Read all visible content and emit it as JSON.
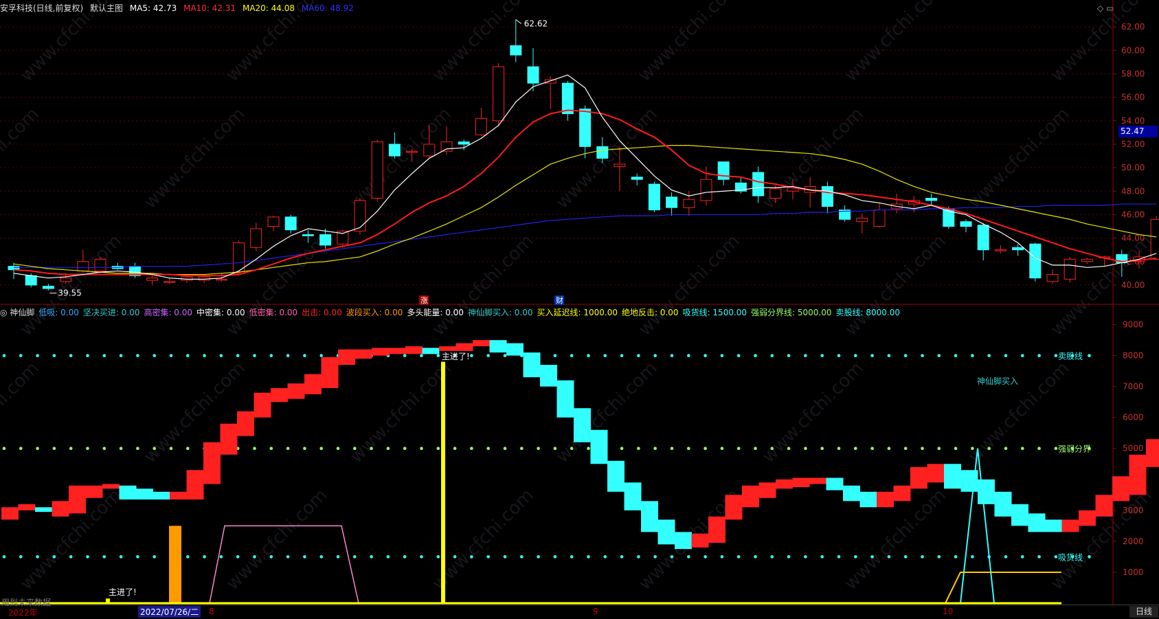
{
  "header": {
    "stock": "安孚科技(日线,前复权)",
    "main_chart_label": "默认主图",
    "ma": [
      {
        "label": "MA5: 42.73",
        "color": "#ffffff"
      },
      {
        "label": "MA10: 42.31",
        "color": "#ff3030"
      },
      {
        "label": "MA20: 44.08",
        "color": "#ffff00"
      },
      {
        "label": "MA60: 48.92",
        "color": "#3030ff"
      }
    ]
  },
  "indicator_header": {
    "name": "神仙脚",
    "items": [
      {
        "label": "低吸: 0.00",
        "color": "#33aaff"
      },
      {
        "label": "坚决买进: 0.00",
        "color": "#33cccc"
      },
      {
        "label": "高密集: 0.00",
        "color": "#cc66ff"
      },
      {
        "label": "中密集: 0.00",
        "color": "#ffffff"
      },
      {
        "label": "低密集: 0.00",
        "color": "#ff66aa"
      },
      {
        "label": "出击: 0.00",
        "color": "#ff2020"
      },
      {
        "label": "波段买入: 0.00",
        "color": "#ff9900"
      },
      {
        "label": "多头能量: 0.00",
        "color": "#ffffff"
      },
      {
        "label": "神仙脚买入: 0.00",
        "color": "#33cccc"
      },
      {
        "label": "买入延迟线: 1000.00",
        "color": "#ffff00"
      },
      {
        "label": "绝地反击: 0.00",
        "color": "#ffff00"
      },
      {
        "label": "吸货线: 1500.00",
        "color": "#33ffff"
      },
      {
        "label": "强弱分界线: 5000.00",
        "color": "#99ff66"
      },
      {
        "label": "卖股线: 8000.00",
        "color": "#33ffff"
      }
    ]
  },
  "chart_data": [
    {
      "type": "candlestick",
      "title": "安孚科技(日线,前复权)",
      "ylim": [
        39,
        63
      ],
      "yticks": [
        "62.00",
        "60.00",
        "58.00",
        "56.00",
        "54.00",
        "52.00",
        "50.00",
        "48.00",
        "46.00",
        "44.00",
        "42.00",
        "40.00"
      ],
      "current_price": "52.47",
      "high_label": "62.62",
      "low_label": "39.55",
      "markers": [
        "涨",
        "财"
      ],
      "candles": [
        [
          41.6,
          41.3,
          41.9,
          40.5
        ],
        [
          40.8,
          40.0,
          41.0,
          39.8
        ],
        [
          39.9,
          39.7,
          40.1,
          39.55
        ],
        [
          40.3,
          40.6,
          41.0,
          40.1
        ],
        [
          41.2,
          42.0,
          43.0,
          41.0
        ],
        [
          41.2,
          42.2,
          42.4,
          41.0
        ],
        [
          41.6,
          41.4,
          41.9,
          41.3
        ],
        [
          41.6,
          40.8,
          41.9,
          40.6
        ],
        [
          40.4,
          40.6,
          40.8,
          40.0
        ],
        [
          40.3,
          40.3,
          40.6,
          40.1
        ],
        [
          40.4,
          40.7,
          40.9,
          40.2
        ],
        [
          40.4,
          40.7,
          40.9,
          40.2
        ],
        [
          40.5,
          40.5,
          41.0,
          40.3
        ],
        [
          41.0,
          43.6,
          43.8,
          40.8
        ],
        [
          43.2,
          44.8,
          45.3,
          42.9
        ],
        [
          45.0,
          45.8,
          45.9,
          44.6
        ],
        [
          45.8,
          44.7,
          46.0,
          44.4
        ],
        [
          44.3,
          44.2,
          44.7,
          43.6
        ],
        [
          44.3,
          43.4,
          44.8,
          43.1
        ],
        [
          43.5,
          44.6,
          44.7,
          43.2
        ],
        [
          44.6,
          47.2,
          47.4,
          44.3
        ],
        [
          47.4,
          52.2,
          52.4,
          47.1
        ],
        [
          52.0,
          51.0,
          53.0,
          50.8
        ],
        [
          51.4,
          51.4,
          51.6,
          50.5
        ],
        [
          51.0,
          52.0,
          53.6,
          50.8
        ],
        [
          51.4,
          52.2,
          53.5,
          51.1
        ],
        [
          52.2,
          52.0,
          52.4,
          51.5
        ],
        [
          52.8,
          54.2,
          55.1,
          52.7
        ],
        [
          54.0,
          58.6,
          58.9,
          53.5
        ],
        [
          60.4,
          59.6,
          62.62,
          59.0
        ],
        [
          58.6,
          57.2,
          60.2,
          56.5
        ],
        [
          57.2,
          57.5,
          57.8,
          55.0
        ],
        [
          57.2,
          54.6,
          57.4,
          54.0
        ],
        [
          55.0,
          51.8,
          55.3,
          50.8
        ],
        [
          51.8,
          50.8,
          52.6,
          50.4
        ],
        [
          50.1,
          50.3,
          51.8,
          48.0
        ],
        [
          49.2,
          49.0,
          49.5,
          48.5
        ],
        [
          48.6,
          46.4,
          48.8,
          46.2
        ],
        [
          47.5,
          46.6,
          47.9,
          45.9
        ],
        [
          46.6,
          47.3,
          48.0,
          45.9
        ],
        [
          47.2,
          49.0,
          50.1,
          46.8
        ],
        [
          50.5,
          49.0,
          50.5,
          48.5
        ],
        [
          48.7,
          48.0,
          49.2,
          47.8
        ],
        [
          49.6,
          47.6,
          50.1,
          47.0
        ],
        [
          47.4,
          48.2,
          48.5,
          47.0
        ],
        [
          48.0,
          48.3,
          49.0,
          47.3
        ],
        [
          47.9,
          48.4,
          49.2,
          46.6
        ],
        [
          48.4,
          46.7,
          48.8,
          46.1
        ],
        [
          46.4,
          45.6,
          46.8,
          45.4
        ],
        [
          45.4,
          45.7,
          46.1,
          44.4
        ],
        [
          45.0,
          46.4,
          47.0,
          44.9
        ],
        [
          46.5,
          46.9,
          47.8,
          46.1
        ],
        [
          46.9,
          47.2,
          47.6,
          46.2
        ],
        [
          47.4,
          47.2,
          47.8,
          46.8
        ],
        [
          46.5,
          45.0,
          46.7,
          44.8
        ],
        [
          45.4,
          45.0,
          45.6,
          44.5
        ],
        [
          45.1,
          43.0,
          45.3,
          42.1
        ],
        [
          43.0,
          43.0,
          43.4,
          42.7
        ],
        [
          43.2,
          43.0,
          43.5,
          42.5
        ],
        [
          43.5,
          40.6,
          43.6,
          40.3
        ],
        [
          40.3,
          40.9,
          41.3,
          40.1
        ],
        [
          40.5,
          42.2,
          42.4,
          40.2
        ],
        [
          42.0,
          42.2,
          42.3,
          41.8
        ],
        [
          42.4,
          42.4,
          42.5,
          41.6
        ],
        [
          42.6,
          41.9,
          43.0,
          40.7
        ],
        [
          42.0,
          42.4,
          42.9,
          41.4
        ],
        [
          42.2,
          45.6,
          45.9,
          42.1
        ]
      ],
      "ma5": [
        41.0,
        40.8,
        40.6,
        40.7,
        40.9,
        41.1,
        41.2,
        41.1,
        40.9,
        40.6,
        40.5,
        40.5,
        40.6,
        41.2,
        42.2,
        43.3,
        44.2,
        44.8,
        44.6,
        44.4,
        44.9,
        46.3,
        48.1,
        49.5,
        50.8,
        51.6,
        51.7,
        52.5,
        53.6,
        55.6,
        56.9,
        57.4,
        57.9,
        56.8,
        54.3,
        52.3,
        50.8,
        49.3,
        48.1,
        47.6,
        47.9,
        48.0,
        48.1,
        48.3,
        48.3,
        48.4,
        48.1,
        48.0,
        47.7,
        47.2,
        47.0,
        46.7,
        46.5,
        46.8,
        46.3,
        46.0,
        45.2,
        44.5,
        43.6,
        42.3,
        41.7,
        41.7,
        41.5,
        41.6,
        41.9,
        42.2,
        42.7
      ],
      "ma10": [
        41.3,
        41.2,
        41.0,
        40.9,
        40.9,
        40.9,
        40.9,
        40.9,
        40.9,
        40.9,
        40.8,
        40.8,
        40.8,
        40.9,
        41.3,
        41.8,
        42.3,
        42.7,
        43.0,
        43.3,
        43.6,
        44.3,
        45.2,
        46.2,
        47.0,
        47.6,
        48.4,
        49.5,
        50.9,
        52.6,
        53.9,
        54.6,
        54.9,
        54.8,
        54.6,
        54.1,
        53.3,
        52.6,
        51.5,
        50.2,
        49.5,
        49.3,
        49.2,
        48.8,
        48.6,
        48.3,
        48.1,
        47.9,
        47.8,
        47.7,
        47.5,
        47.3,
        47.1,
        46.8,
        46.5,
        46.1,
        45.6,
        45.1,
        44.6,
        44.1,
        43.6,
        43.1,
        42.7,
        42.3,
        42.0,
        42.1,
        42.3
      ],
      "ma20": [
        41.8,
        41.6,
        41.4,
        41.3,
        41.2,
        41.1,
        41.0,
        41.0,
        41.0,
        40.9,
        40.9,
        40.9,
        41.0,
        41.1,
        41.3,
        41.5,
        41.7,
        41.9,
        42.0,
        42.2,
        42.4,
        42.9,
        43.5,
        44.0,
        44.6,
        45.2,
        45.9,
        46.6,
        47.5,
        48.5,
        49.4,
        50.3,
        50.8,
        51.2,
        51.5,
        51.6,
        51.7,
        51.8,
        51.9,
        51.9,
        51.8,
        51.7,
        51.6,
        51.5,
        51.4,
        51.3,
        51.2,
        51.0,
        50.7,
        50.3,
        49.7,
        49.0,
        48.4,
        47.9,
        47.6,
        47.3,
        47.1,
        46.8,
        46.5,
        46.2,
        45.9,
        45.6,
        45.2,
        44.9,
        44.6,
        44.3,
        44.1
      ],
      "ma60": [
        41.5,
        41.5,
        41.5,
        41.5,
        41.5,
        41.5,
        41.5,
        41.6,
        41.6,
        41.6,
        41.6,
        41.7,
        41.8,
        41.9,
        42.1,
        42.3,
        42.5,
        42.7,
        42.9,
        43.1,
        43.3,
        43.5,
        43.7,
        43.9,
        44.1,
        44.3,
        44.5,
        44.7,
        44.9,
        45.1,
        45.3,
        45.5,
        45.6,
        45.7,
        45.8,
        45.9,
        45.9,
        45.9,
        46.0,
        46.0,
        46.0,
        46.0,
        46.0,
        46.0,
        46.1,
        46.1,
        46.2,
        46.2,
        46.3,
        46.3,
        46.4,
        46.4,
        46.4,
        46.5,
        46.5,
        46.6,
        46.6,
        46.6,
        46.7,
        46.7,
        46.8,
        46.8,
        46.8,
        46.8,
        46.9,
        46.9,
        46.9
      ]
    },
    {
      "type": "bar",
      "title": "神仙脚",
      "ylim": [
        0,
        9500
      ],
      "yticks": [
        "9000",
        "8000",
        "7000",
        "6000",
        "5000",
        "4000",
        "3000",
        "2000",
        "1000"
      ],
      "energy_steps": [
        [
          2700,
          3100
        ],
        [
          3000,
          3200
        ],
        [
          2950,
          3100
        ],
        [
          2800,
          3300
        ],
        [
          2900,
          3800
        ],
        [
          3400,
          3800
        ],
        [
          3700,
          3850
        ],
        [
          3350,
          3800
        ],
        [
          3350,
          3700
        ],
        [
          3350,
          3600
        ],
        [
          3350,
          3600
        ],
        [
          3350,
          4300
        ],
        [
          3850,
          5200
        ],
        [
          4800,
          5800
        ],
        [
          5400,
          6200
        ],
        [
          6000,
          6800
        ],
        [
          6500,
          6950
        ],
        [
          6600,
          7100
        ],
        [
          6750,
          7400
        ],
        [
          6950,
          7950
        ],
        [
          7700,
          8200
        ],
        [
          7900,
          8200
        ],
        [
          8000,
          8250
        ],
        [
          8050,
          8250
        ],
        [
          8050,
          8300
        ],
        [
          8050,
          8250
        ],
        [
          8150,
          8300
        ],
        [
          8150,
          8400
        ],
        [
          8300,
          8500
        ],
        [
          8100,
          8500
        ],
        [
          8000,
          8400
        ],
        [
          7300,
          8100
        ],
        [
          7000,
          7700
        ],
        [
          6000,
          7200
        ],
        [
          5200,
          6300
        ],
        [
          4500,
          5600
        ],
        [
          3600,
          4600
        ],
        [
          3000,
          3900
        ],
        [
          2300,
          3300
        ],
        [
          1900,
          2700
        ],
        [
          1750,
          2300
        ],
        [
          1800,
          2250
        ],
        [
          1950,
          2800
        ],
        [
          2700,
          3500
        ],
        [
          3100,
          3800
        ],
        [
          3400,
          3900
        ],
        [
          3700,
          4000
        ],
        [
          3750,
          4050
        ],
        [
          3850,
          4050
        ],
        [
          3650,
          4050
        ],
        [
          3300,
          3800
        ],
        [
          3100,
          3600
        ],
        [
          3100,
          3600
        ],
        [
          3300,
          3800
        ],
        [
          3700,
          4400
        ],
        [
          3900,
          4500
        ],
        [
          3700,
          4500
        ],
        [
          3600,
          4300
        ],
        [
          3200,
          4000
        ],
        [
          2800,
          3600
        ],
        [
          2500,
          3200
        ],
        [
          2300,
          2900
        ],
        [
          2300,
          2700
        ],
        [
          2300,
          2700
        ],
        [
          2500,
          3000
        ],
        [
          2800,
          3500
        ],
        [
          3300,
          4100
        ],
        [
          3500,
          4800
        ],
        [
          4400,
          5300
        ]
      ],
      "reference_lines": [
        {
          "name": "卖股线",
          "value": 8000,
          "color": "#33ffff"
        },
        {
          "name": "强弱分界",
          "value": 5000,
          "color": "#99ff66"
        },
        {
          "name": "吸货线",
          "value": 1500,
          "color": "#33ffff"
        }
      ],
      "annotations": [
        "主进了!",
        "主进了!",
        "神仙脚买入"
      ],
      "x_labels": [
        "2022年",
        "8",
        "9",
        "10"
      ],
      "current_date": "2022/07/26/二",
      "period": "日线",
      "footer": "用到未来数据"
    }
  ],
  "colors": {
    "up": "#ff2020",
    "down": "#33ffff",
    "axis": "#a00000",
    "grid": "#5a0000"
  },
  "watermark": "www.cfchi.com"
}
